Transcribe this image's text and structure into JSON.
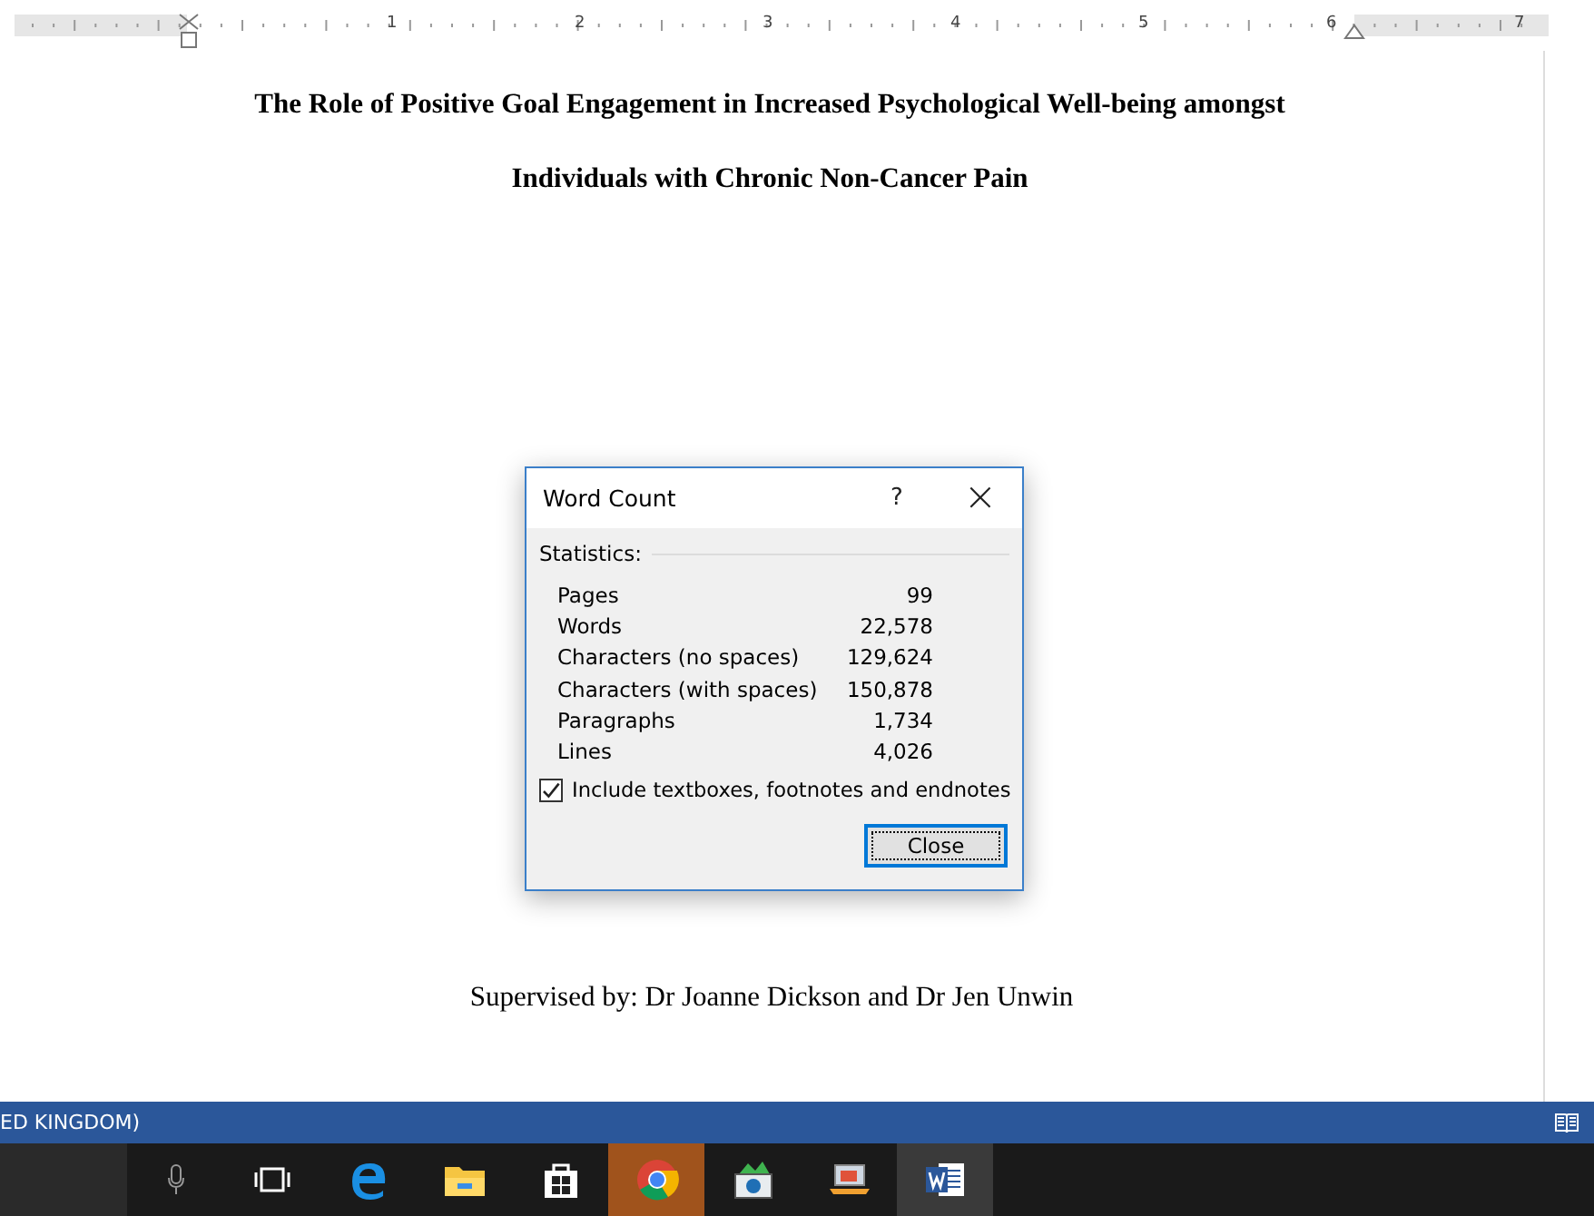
{
  "ruler": {
    "numbers": [
      "1",
      "2",
      "3",
      "4",
      "5",
      "6",
      "7"
    ]
  },
  "document": {
    "title_lines": [
      "The Role of Positive Goal Engagement in Increased Psychological Well-being amongst",
      "Individuals with Chronic Non-Cancer Pain"
    ],
    "supervised": "Supervised by: Dr Joanne Dickson and Dr Jen Unwin"
  },
  "dialog": {
    "title": "Word Count",
    "help": "?",
    "close_glyph": "×",
    "section": "Statistics:",
    "stats": [
      {
        "label": "Pages",
        "value": "99"
      },
      {
        "label": "Words",
        "value": "22,578"
      },
      {
        "label": "Characters (no spaces)",
        "value": "129,624"
      },
      {
        "label": "Characters (with spaces)",
        "value": "150,878"
      },
      {
        "label": "Paragraphs",
        "value": "1,734"
      },
      {
        "label": "Lines",
        "value": "4,026"
      }
    ],
    "include": {
      "label": "Include textboxes, footnotes and endnotes",
      "checked": true
    },
    "button": "Close"
  },
  "status_bar": {
    "language": "ED KINGDOM)"
  },
  "taskbar": {
    "apps": [
      {
        "kind": "mic",
        "selected": false,
        "open": false
      },
      {
        "kind": "taskview",
        "selected": false,
        "open": false
      },
      {
        "kind": "edge",
        "selected": false,
        "open": false
      },
      {
        "kind": "folder",
        "selected": false,
        "open": false
      },
      {
        "kind": "store",
        "selected": false,
        "open": false
      },
      {
        "kind": "chrome",
        "selected": true,
        "open": false
      },
      {
        "kind": "hp",
        "selected": false,
        "open": false
      },
      {
        "kind": "laptop",
        "selected": false,
        "open": false
      },
      {
        "kind": "word",
        "selected": false,
        "open": true
      }
    ]
  }
}
